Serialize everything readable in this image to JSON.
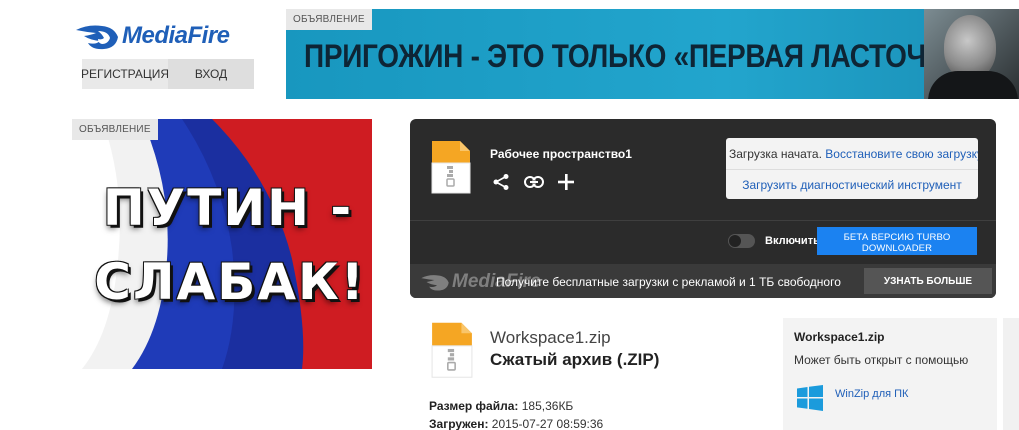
{
  "header": {
    "logo_text": "MediaFire",
    "register_label": "РЕГИСТРАЦИЯ",
    "login_label": "ВХОД"
  },
  "top_ad": {
    "label": "ОБЪЯВЛЕНИЕ",
    "headline": "ПРИГОЖИН - ЭТО ТОЛЬКО «ПЕРВАЯ ЛАСТОЧКА»"
  },
  "left_ad": {
    "label": "ОБЪЯВЛЕНИЕ",
    "line1": "ПУТИН -",
    "line2": "СЛАБАК!"
  },
  "download_panel": {
    "file_name": "Рабочее пространство1",
    "status_prefix": "Загрузка начата.",
    "status_link": "Восстановите свою загрузку",
    "diagnostic_link": "Загрузить диагностический инструмент",
    "toggle_label": "Включить",
    "turbo_button": "БЕТА ВЕРСИЮ TURBO DOWNLOADER",
    "promo_logo": "MediaFire",
    "promo_text": "Получите бесплатные загрузки с рекламой и 1 ТБ свободного",
    "learn_more_button": "УЗНАТЬ БОЛЬШЕ"
  },
  "file_info": {
    "name": "Workspace1.zip",
    "type": "Сжатый архив (.ZIP)",
    "size_label": "Размер файла:",
    "size_value": "185,36КБ",
    "uploaded_label": "Загружен:",
    "uploaded_value": "2015-07-27 08:59:36"
  },
  "sidebar": {
    "title": "Workspace1.zip",
    "subtitle": "Может быть открыт с помощью",
    "app_label": "WinZip для ПК"
  },
  "colors": {
    "brand_blue": "#1f5fb8",
    "panel_dark": "#2b2b2b",
    "turbo_blue": "#1b82f1",
    "file_orange": "#f5a623"
  }
}
